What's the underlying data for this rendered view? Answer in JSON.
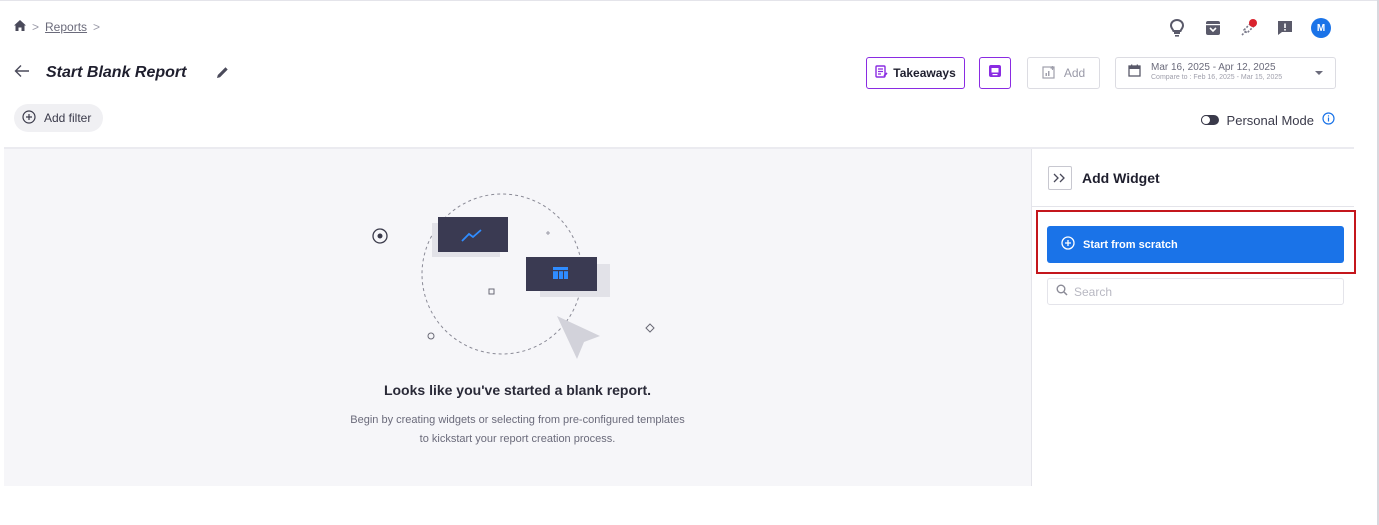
{
  "breadcrumb": {
    "home_icon": "home-icon",
    "item": "Reports"
  },
  "top_icons": [
    "lightbulb-icon",
    "archive-icon",
    "rocket-notification-icon",
    "feedback-icon"
  ],
  "user": {
    "initial": "M"
  },
  "header": {
    "title": "Start Blank Report"
  },
  "toolbar": {
    "takeaways_label": "Takeaways",
    "add_label": "Add",
    "date_range": "Mar 16, 2025 - Apr 12, 2025",
    "compare_range": "Compare to : Feb 16, 2025 - Mar 15, 2025"
  },
  "filter": {
    "add_filter_label": "Add filter"
  },
  "personal_mode": {
    "label": "Personal Mode",
    "enabled": false
  },
  "empty_state": {
    "title": "Looks like you've started a blank report.",
    "line1": "Begin by creating widgets or selecting from pre-configured templates",
    "line2": "to kickstart your report creation process."
  },
  "panel": {
    "title": "Add Widget",
    "start_label": "Start from scratch",
    "search_placeholder": "Search"
  },
  "colors": {
    "primary": "#1a73e8",
    "accent": "#8a2be2",
    "highlight": "#c4161c"
  }
}
